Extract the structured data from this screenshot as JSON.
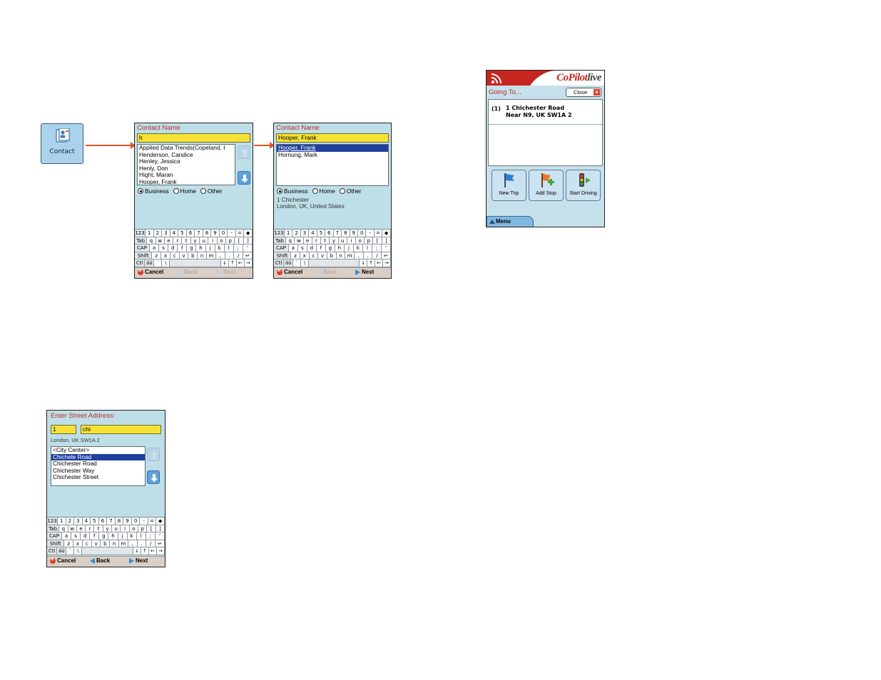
{
  "contact_icon": {
    "label": "Contact"
  },
  "contact_screen_1": {
    "title": "Contact Name",
    "input_value": "h",
    "list_items": [
      "Applied Data Trends(Copeland, I",
      "Henderson, Candice",
      "Henley, Jessica",
      "Henly, Don",
      "Hight, Maran",
      "Hooper, Frank"
    ],
    "radios": [
      "Business",
      "Home",
      "Other"
    ],
    "selected_radio": "Business",
    "bottom": {
      "cancel": "Cancel",
      "back": "Back",
      "next": "Next"
    }
  },
  "contact_screen_2": {
    "title": "Contact Name",
    "input_value": "Hooper, Frank",
    "list_items": [
      "Hooper, Frank",
      "Hornung, Mark"
    ],
    "selected_index": 0,
    "radios": [
      "Business",
      "Home",
      "Other"
    ],
    "selected_radio": "Business",
    "address_line1": "1 Chichester",
    "address_line2": "London, UK, United States",
    "bottom": {
      "cancel": "Cancel",
      "back": "Back",
      "next": "Next"
    }
  },
  "street_screen": {
    "title": "Enter Street Address:",
    "house_number": "1",
    "street_value": "chi",
    "postcode_line": "London, UK SW1A 2",
    "list_items": [
      "<City Center>",
      "Chichele Road",
      "Chichester Road",
      "Chichester Way",
      "Chichester Street"
    ],
    "selected_index": 1,
    "bottom": {
      "cancel": "Cancel",
      "back": "Back",
      "next": "Next"
    }
  },
  "copilot_screen": {
    "brand": "CoPilot",
    "brand_suffix": "live",
    "heading": "Going To...",
    "close_label": "Close",
    "stop_index": "(1)",
    "stop_line1": "1 Chichester Road",
    "stop_line2": "Near N9, UK SW1A 2",
    "buttons": [
      "New Trip",
      "Add Stop",
      "Start Driving"
    ],
    "menu_label": "Menu"
  },
  "keyboard": {
    "rows": [
      [
        "123",
        "1",
        "2",
        "3",
        "4",
        "5",
        "6",
        "7",
        "8",
        "9",
        "0",
        "-",
        "=",
        "◆"
      ],
      [
        "Tab",
        "q",
        "w",
        "e",
        "r",
        "t",
        "y",
        "u",
        "i",
        "o",
        "p",
        "[",
        "]"
      ],
      [
        "CAP",
        "a",
        "s",
        "d",
        "f",
        "g",
        "h",
        "j",
        "k",
        "l",
        ";",
        "'"
      ],
      [
        "Shift",
        "z",
        "x",
        "c",
        "v",
        "b",
        "n",
        "m",
        ",",
        ".",
        "/",
        "↵"
      ],
      [
        "Ctl",
        "áü",
        "`",
        "\\",
        "",
        "↓",
        "↑",
        "←",
        "→"
      ]
    ]
  },
  "colors": {
    "accent_red": "#c7251f",
    "screen_bg": "#bfdfe8",
    "input_yellow": "#f6e236",
    "selection_blue": "#1f3f9c"
  }
}
